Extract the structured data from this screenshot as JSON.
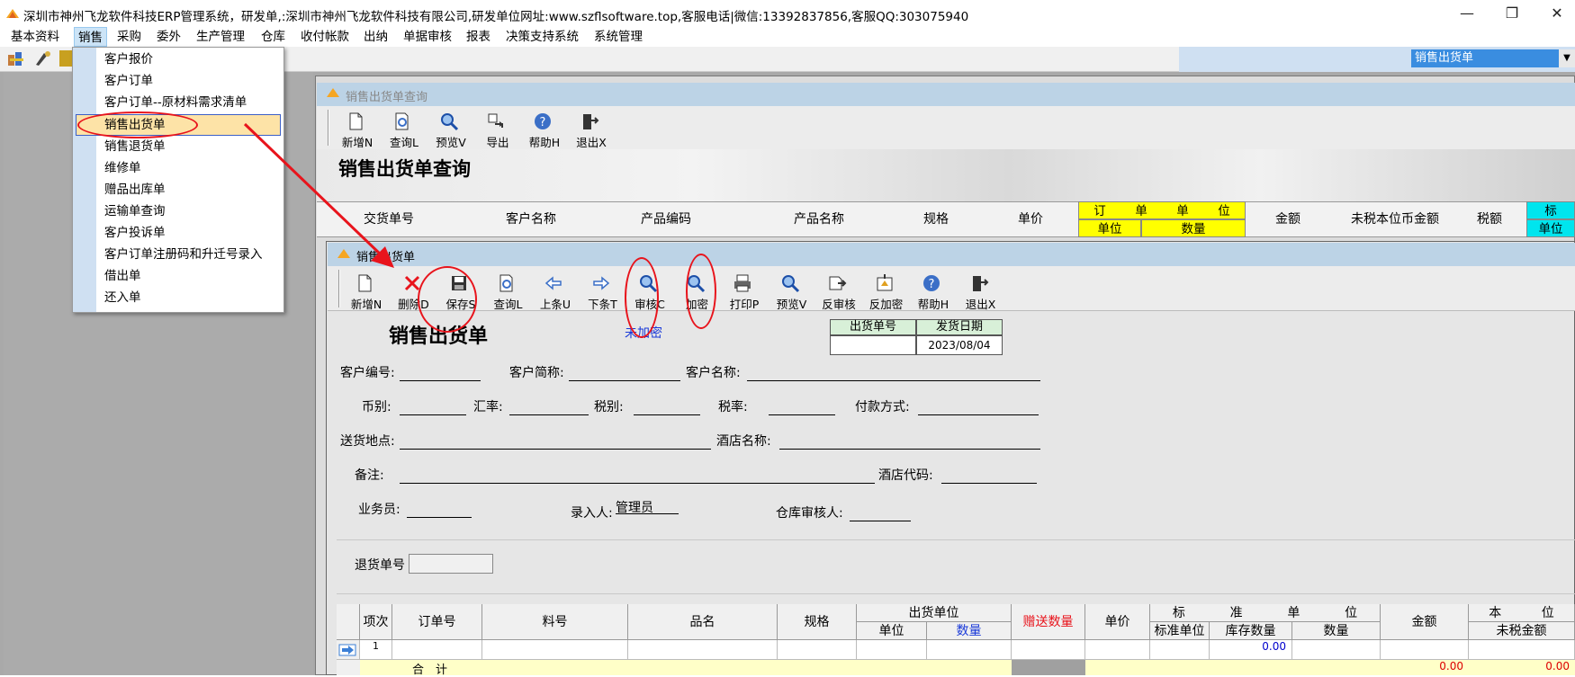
{
  "window": {
    "title": "深圳市神州飞龙软件科技ERP管理系统，研发单,:深圳市神州飞龙软件科技有限公司,研发单位网址:www.szflsoftware.top,客服电话|微信:13392837856,客服QQ:303075940",
    "minimize": "—",
    "restore": "❐",
    "close": "✕"
  },
  "menu": [
    "基本资料",
    "销售",
    "采购",
    "委外",
    "生产管理",
    "仓库",
    "收付帐款",
    "出纳",
    "单据审核",
    "报表",
    "决策支持系统",
    "系统管理"
  ],
  "combo": {
    "value": "销售出货单"
  },
  "dropdown": {
    "items": [
      "客户报价",
      "客户订单",
      "客户订单--原材料需求清单",
      "销售出货单",
      "销售退货单",
      "维修单",
      "赠品出库单",
      "运输单查询",
      "客户投诉单",
      "客户订单注册码和升迁号录入",
      "借出单",
      "还入单"
    ],
    "highlighted": "销售出货单"
  },
  "query_window": {
    "title": "销售出货单查询",
    "toolbar": [
      {
        "label": "新增N",
        "icon": "new-doc-icon"
      },
      {
        "label": "查询L",
        "icon": "query-icon"
      },
      {
        "label": "预览V",
        "icon": "preview-icon"
      },
      {
        "label": "导出",
        "icon": "export-icon"
      },
      {
        "label": "帮助H",
        "icon": "help-icon"
      },
      {
        "label": "退出X",
        "icon": "exit-icon"
      }
    ],
    "banner": "销售出货单查询",
    "columns": [
      "交货单号",
      "客户名称",
      "产品编码",
      "产品名称",
      "规格",
      "单价"
    ],
    "order_unit_group": {
      "top": [
        "订",
        "单",
        "单",
        "位"
      ],
      "bottom": [
        "单位",
        "数量"
      ]
    },
    "columns2": [
      "金额",
      "未税本位币金额",
      "税额"
    ],
    "std_group": {
      "top": "标",
      "bottom": "单位"
    }
  },
  "form_window": {
    "title": "销售出货单",
    "toolbar": [
      {
        "label": "新增N",
        "icon": "new-doc-icon"
      },
      {
        "label": "删除D",
        "icon": "delete-icon"
      },
      {
        "label": "保存S",
        "icon": "save-icon"
      },
      {
        "label": "查询L",
        "icon": "query-icon"
      },
      {
        "label": "上条U",
        "icon": "arrow-left-icon"
      },
      {
        "label": "下条T",
        "icon": "arrow-right-icon"
      },
      {
        "label": "审核C",
        "icon": "audit-icon"
      },
      {
        "label": "加密",
        "icon": "encrypt-icon"
      },
      {
        "label": "打印P",
        "icon": "print-icon"
      },
      {
        "label": "预览V",
        "icon": "preview-icon"
      },
      {
        "label": "反审核",
        "icon": "unaudit-icon"
      },
      {
        "label": "反加密",
        "icon": "decrypt-icon"
      },
      {
        "label": "帮助H",
        "icon": "help-icon"
      },
      {
        "label": "退出X",
        "icon": "exit-icon"
      }
    ],
    "heading": "销售出货单",
    "encrypt_status": "未加密",
    "doc_box": {
      "no_label": "出货单号",
      "date_label": "发货日期",
      "no_value": "",
      "date_value": "2023/08/04"
    },
    "fields": {
      "customer_no": "客户编号:",
      "customer_short": "客户简称:",
      "customer_name": "客户名称:",
      "currency": "币别:",
      "exchange_rate": "汇率:",
      "tax_type": "税别:",
      "tax_rate": "税率:",
      "payment": "付款方式:",
      "delivery": "送货地点:",
      "hotel_name": "酒店名称:",
      "remark": "备注:",
      "hotel_code": "酒店代码:",
      "salesman": "业务员:",
      "entered_by": "录入人:",
      "entered_by_value": "管理员",
      "warehouse_auditor": "仓库审核人:",
      "return_no": "退货单号"
    },
    "grid": {
      "headers": {
        "item": "项次",
        "order_no": "订单号",
        "part_no": "料号",
        "name": "品名",
        "spec": "规格",
        "ship_unit": "出货单位",
        "unit": "单位",
        "qty": "数量",
        "gift_qty": "赠送数量",
        "price": "单价",
        "std_top": [
          "标",
          "准",
          "单",
          "位"
        ],
        "std_unit": "标准单位",
        "stock_qty": "库存数量",
        "std_qty": "数量",
        "amount": "金额",
        "local_top": [
          "本",
          "位"
        ],
        "untaxed": "未税金额"
      },
      "row": {
        "index": "1",
        "std_qty_value": "0.00"
      },
      "total": {
        "label": "合　计",
        "amount": "0.00",
        "untaxed": "0.00"
      }
    }
  }
}
